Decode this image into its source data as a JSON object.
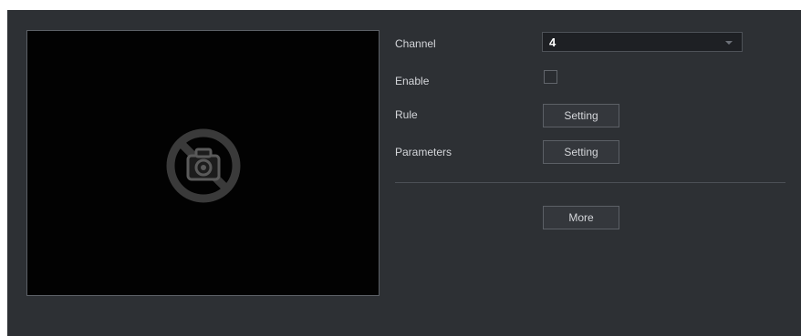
{
  "form": {
    "channel_label": "Channel",
    "channel_value": "4",
    "enable_label": "Enable",
    "enable_checked": false,
    "rule_label": "Rule",
    "rule_button": "Setting",
    "parameters_label": "Parameters",
    "parameters_button": "Setting",
    "more_button": "More"
  },
  "preview": {
    "status_icon": "no-camera-icon"
  },
  "colors": {
    "panel_bg": "#2d3034",
    "preview_bg": "#020202",
    "text": "#d4d6da"
  }
}
